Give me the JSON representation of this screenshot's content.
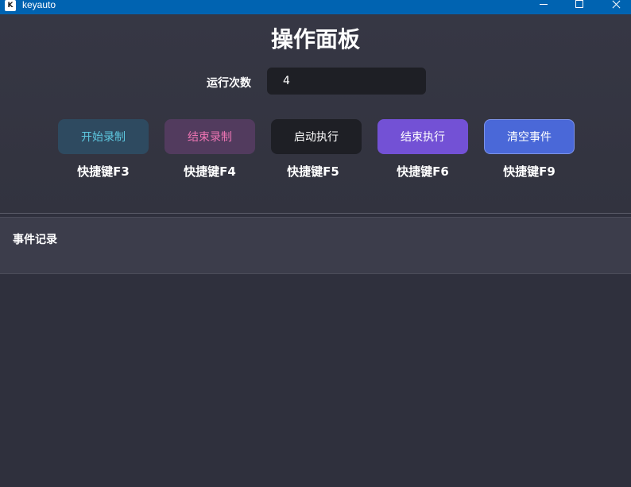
{
  "window": {
    "title": "keyauto",
    "icon_letter": "K",
    "controls": [
      "minimize-icon",
      "maximize-icon",
      "close-icon"
    ],
    "titlebar_color": "#0063b1"
  },
  "panel": {
    "title": "操作面板",
    "run_count_label": "运行次数",
    "run_count_value": "4",
    "buttons": [
      {
        "label": "开始录制",
        "hotkey": "快捷键F3",
        "color": "#2e4a60",
        "text_color": "#5ec8e0"
      },
      {
        "label": "结束录制",
        "hotkey": "快捷键F4",
        "color": "#523b5e",
        "text_color": "#ec74b3"
      },
      {
        "label": "启动执行",
        "hotkey": "快捷键F5",
        "color": "#1e1f25",
        "text_color": "#ffffff"
      },
      {
        "label": "结束执行",
        "hotkey": "快捷键F6",
        "color": "#7351d5",
        "text_color": "#ffffff"
      },
      {
        "label": "清空事件",
        "hotkey": "快捷键F9",
        "color": "#4a68d8",
        "text_color": "#ffffff"
      }
    ]
  },
  "events": {
    "title": "事件记录"
  },
  "theme": {
    "background": "#2f303d",
    "panel_background": "#363744",
    "events_background": "#3c3d4b"
  }
}
